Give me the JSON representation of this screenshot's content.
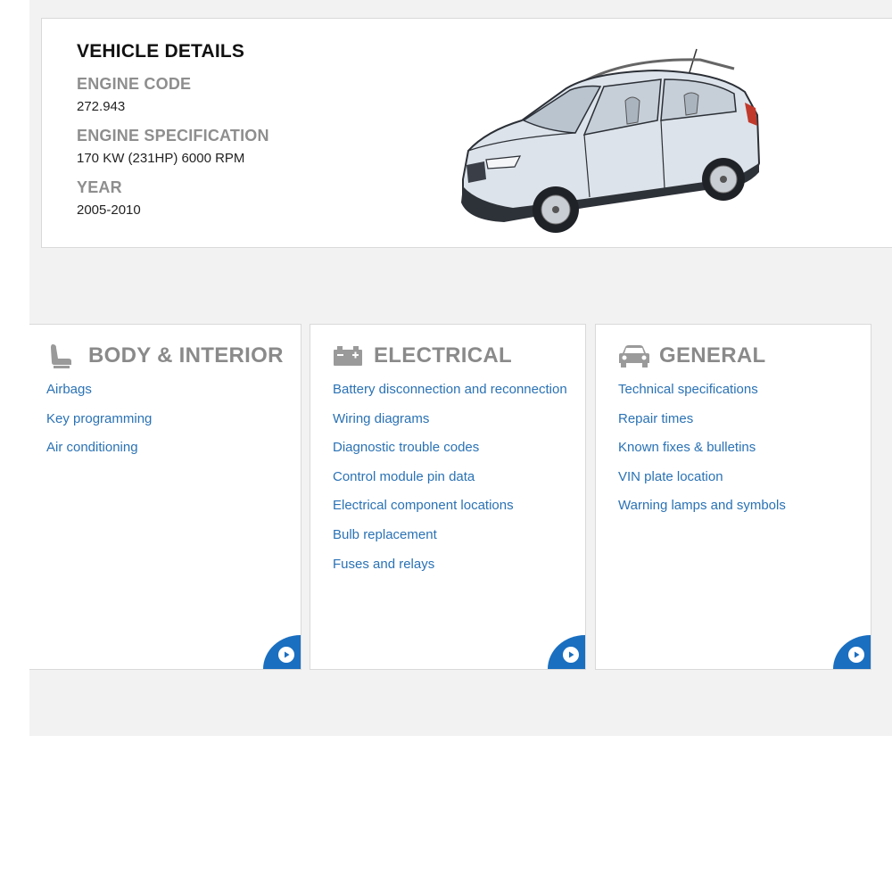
{
  "vehicle_details": {
    "title": "VEHICLE DETAILS",
    "engine_code_label": "ENGINE CODE",
    "engine_code": "272.943",
    "engine_spec_label": "ENGINE SPECIFICATION",
    "engine_spec": "170 KW (231HP) 6000 RPM",
    "year_label": "YEAR",
    "year": "2005-2010"
  },
  "categories": [
    {
      "title": "BODY & INTERIOR",
      "icon": "seat-icon",
      "links": [
        "Airbags",
        "Key programming",
        "Air conditioning"
      ]
    },
    {
      "title": "ELECTRICAL",
      "icon": "battery-icon",
      "links": [
        "Battery disconnection and reconnection",
        "Wiring diagrams",
        "Diagnostic trouble codes",
        "Control module pin data",
        "Electrical component locations",
        "Bulb replacement",
        "Fuses and relays"
      ]
    },
    {
      "title": "GENERAL",
      "icon": "car-icon",
      "links": [
        "Technical specifications",
        "Repair times",
        "Known fixes & bulletins",
        "VIN plate location",
        "Warning lamps and symbols"
      ]
    }
  ],
  "colors": {
    "link": "#2a72b5",
    "accent": "#1a6fc0",
    "heading_gray": "#8a8a8a",
    "background": "#f2f2f2"
  }
}
